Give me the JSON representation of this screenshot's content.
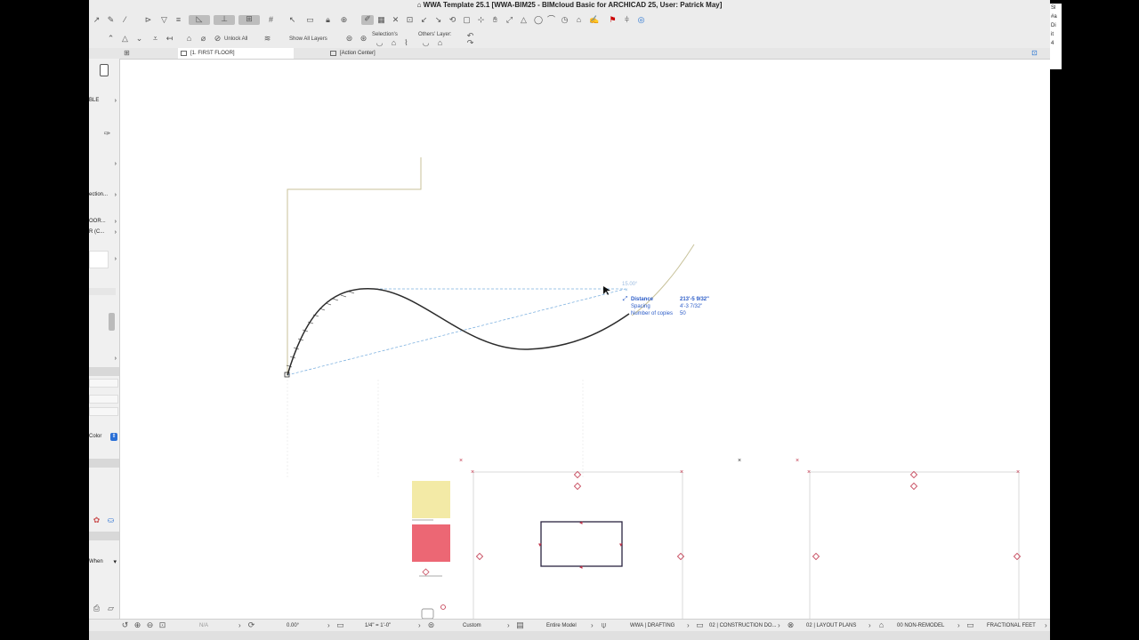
{
  "window": {
    "title": "WWA Template 25.1 [WWA-BIM25 - BIMcloud Basic for ARCHICAD 25, User: Patrick May]"
  },
  "toolbar2": {
    "unlock_all": "Unlock All",
    "show_all_layers": "Show All Layers",
    "selection_label": "Selection's",
    "others_layer_label": "Others' Layer:"
  },
  "tabs": [
    {
      "label": "[1. FIRST FLOOR]"
    },
    {
      "label": "[Action Center]"
    }
  ],
  "infobox": {
    "items": [
      {
        "label": "BLE"
      },
      {
        "label": "ection..."
      },
      {
        "label": "OOR..."
      },
      {
        "label": "R (C..."
      },
      {
        "label": "Color"
      },
      {
        "label": "When"
      }
    ]
  },
  "canvas": {
    "angle_hint": "15.00°",
    "tooltip": {
      "rows": [
        {
          "label": "Distance",
          "value": "213'-5 9/32\""
        },
        {
          "label": "Spacing",
          "value": "4'-3 7/32\""
        },
        {
          "label": "Number of copies",
          "value": "50"
        }
      ]
    },
    "colors": {
      "curve": "#2b2b2b",
      "guide_dashed": "#7fb2e0",
      "wall_line": "#c8c29a",
      "swatch_yellow": "#f3eaa6",
      "swatch_red": "#ec6774",
      "marker": "#c0344a",
      "tooltip_blue": "#2a5bc7"
    }
  },
  "statusbar": {
    "na": "N/A",
    "angle": "0.00°",
    "scale": "1/4\" = 1'-0\"",
    "pen_set": "Custom",
    "model_view": "Entire Model",
    "layer_combo": "WWA | DRAFTING",
    "view_set": "02 | CONSTRUCTION DO...",
    "layout": "02 | LAYOUT PLANS",
    "renovation": "00 NON-REMODEL",
    "dimension": "FRACTIONAL FEET"
  },
  "right_panel": {
    "lines": [
      "Sl",
      "#a",
      "Di",
      "it",
      "4"
    ]
  }
}
